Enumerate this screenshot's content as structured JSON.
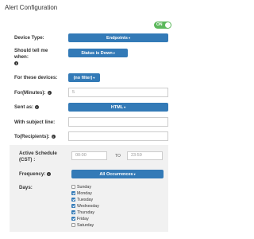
{
  "header": {
    "title": "Alert Configuration",
    "toggle_label": "ON"
  },
  "labels": {
    "device_type": "Device Type:",
    "should_tell_line1": "Should tell me",
    "should_tell_line2": "when:",
    "for_devices": "For these devices:",
    "for_minutes": "For(Minutes):",
    "sent_as": "Sent as:",
    "subject": "With subject line:",
    "to_recipients": "To(Recipients):",
    "schedule_line1": "Active Schedule",
    "schedule_line2": "(CST) :",
    "frequency": "Frequency:",
    "days": "Days:"
  },
  "buttons": {
    "endpoints": "Endpoints",
    "status": "Status is Down",
    "filter": "(no filter)",
    "html": "HTML",
    "all_occurrences": "All Occurrences"
  },
  "fields": {
    "minutes_value": "5",
    "subject_value": "",
    "recipients_value": "",
    "start_time": "00:00",
    "end_time": "23:59",
    "to_text": "TO"
  },
  "days": [
    {
      "name": "Sunday",
      "checked": false
    },
    {
      "name": "Monday",
      "checked": true
    },
    {
      "name": "Tuesday",
      "checked": true
    },
    {
      "name": "Wednesday",
      "checked": true
    },
    {
      "name": "Thursday",
      "checked": true
    },
    {
      "name": "Friday",
      "checked": true
    },
    {
      "name": "Saturday",
      "checked": false
    }
  ],
  "colors": {
    "primary": "#337ab7",
    "toggle_on": "#5cb85c"
  }
}
